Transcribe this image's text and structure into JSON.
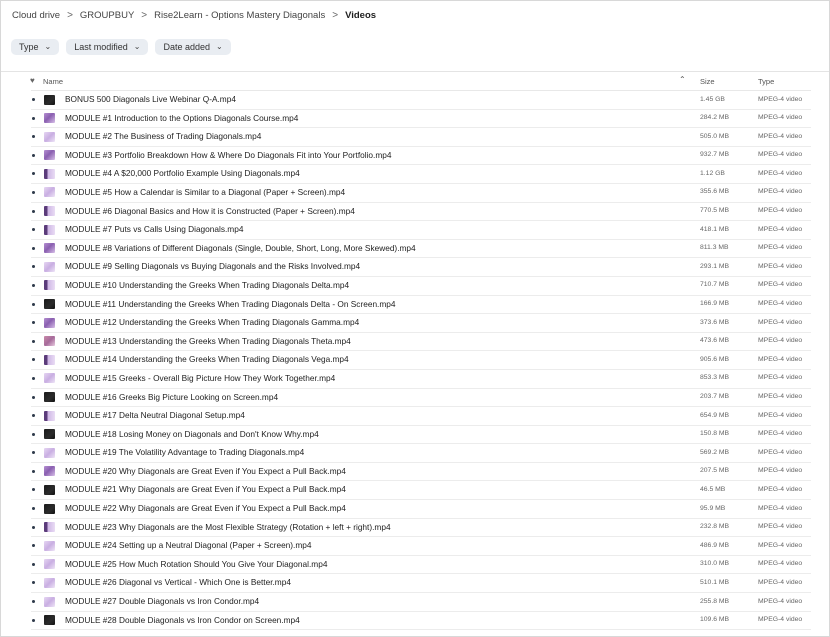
{
  "breadcrumb": {
    "items": [
      "Cloud drive",
      "GROUPBUY",
      "Rise2Learn - Options Mastery Diagonals",
      "Videos"
    ],
    "separator": ">"
  },
  "filters": [
    {
      "label": "Type"
    },
    {
      "label": "Last modified"
    },
    {
      "label": "Date added"
    }
  ],
  "table": {
    "columns": {
      "name": "Name",
      "size": "Size",
      "type": "Type"
    },
    "rows": [
      {
        "name": "BONUS 500 Diagonals Live Webinar Q-A.mp4",
        "size": "1.45 GB",
        "type": "MPEG-4 video",
        "thumb": "dark"
      },
      {
        "name": "MODULE #1 Introduction to the Options Diagonals Course.mp4",
        "size": "284.2 MB",
        "type": "MPEG-4 video",
        "thumb": "photo"
      },
      {
        "name": "MODULE #2 The Business of Trading Diagonals.mp4",
        "size": "505.0 MB",
        "type": "MPEG-4 video",
        "thumb": "lilac"
      },
      {
        "name": "MODULE #3 Portfolio Breakdown How & Where Do Diagonals Fit into Your Portfolio.mp4",
        "size": "932.7 MB",
        "type": "MPEG-4 video",
        "thumb": "photo"
      },
      {
        "name": "MODULE #4 A $20,000 Portfolio Example Using Diagonals.mp4",
        "size": "1.12 GB",
        "type": "MPEG-4 video",
        "thumb": "mixed"
      },
      {
        "name": "MODULE #5 How a Calendar is Similar to a Diagonal (Paper + Screen).mp4",
        "size": "355.6 MB",
        "type": "MPEG-4 video",
        "thumb": "lilac"
      },
      {
        "name": "MODULE #6 Diagonal Basics and How it is Constructed (Paper + Screen).mp4",
        "size": "770.5 MB",
        "type": "MPEG-4 video",
        "thumb": "mixed"
      },
      {
        "name": "MODULE #7 Puts vs Calls Using Diagonals.mp4",
        "size": "418.1 MB",
        "type": "MPEG-4 video",
        "thumb": "mixed"
      },
      {
        "name": "MODULE #8 Variations of Different Diagonals (Single, Double, Short, Long, More Skewed).mp4",
        "size": "811.3 MB",
        "type": "MPEG-4 video",
        "thumb": "photo"
      },
      {
        "name": "MODULE #9 Selling Diagonals vs Buying Diagonals and the Risks Involved.mp4",
        "size": "293.1 MB",
        "type": "MPEG-4 video",
        "thumb": "lilac"
      },
      {
        "name": "MODULE #10 Understanding the Greeks When Trading Diagonals Delta.mp4",
        "size": "710.7 MB",
        "type": "MPEG-4 video",
        "thumb": "mixed"
      },
      {
        "name": "MODULE #11 Understanding the Greeks When Trading Diagonals Delta - On Screen.mp4",
        "size": "166.9 MB",
        "type": "MPEG-4 video",
        "thumb": "dark"
      },
      {
        "name": "MODULE #12 Understanding the Greeks When Trading Diagonals Gamma.mp4",
        "size": "373.6 MB",
        "type": "MPEG-4 video",
        "thumb": "photo"
      },
      {
        "name": "MODULE #13 Understanding the Greeks When Trading Diagonals Theta.mp4",
        "size": "473.6 MB",
        "type": "MPEG-4 video",
        "thumb": "warm"
      },
      {
        "name": "MODULE #14 Understanding the Greeks When Trading Diagonals Vega.mp4",
        "size": "905.6 MB",
        "type": "MPEG-4 video",
        "thumb": "mixed"
      },
      {
        "name": "MODULE #15 Greeks - Overall Big Picture How They Work Together.mp4",
        "size": "853.3 MB",
        "type": "MPEG-4 video",
        "thumb": "lilac"
      },
      {
        "name": "MODULE #16 Greeks Big Picture Looking on Screen.mp4",
        "size": "203.7 MB",
        "type": "MPEG-4 video",
        "thumb": "dark"
      },
      {
        "name": "MODULE #17 Delta Neutral Diagonal Setup.mp4",
        "size": "654.9 MB",
        "type": "MPEG-4 video",
        "thumb": "mixed"
      },
      {
        "name": "MODULE #18 Losing Money on Diagonals and Don't Know Why.mp4",
        "size": "150.8 MB",
        "type": "MPEG-4 video",
        "thumb": "dark"
      },
      {
        "name": "MODULE #19 The Volatility Advantage to Trading Diagonals.mp4",
        "size": "569.2 MB",
        "type": "MPEG-4 video",
        "thumb": "lilac"
      },
      {
        "name": "MODULE #20 Why Diagonals are Great Even if You Expect a Pull Back.mp4",
        "size": "207.5 MB",
        "type": "MPEG-4 video",
        "thumb": "photo"
      },
      {
        "name": "MODULE #21 Why Diagonals are Great Even if You Expect a Pull Back.mp4",
        "size": "46.5 MB",
        "type": "MPEG-4 video",
        "thumb": "dark"
      },
      {
        "name": "MODULE #22 Why Diagonals are Great Even if You Expect a Pull Back.mp4",
        "size": "95.9 MB",
        "type": "MPEG-4 video",
        "thumb": "dark"
      },
      {
        "name": "MODULE #23 Why Diagonals are the Most Flexible Strategy (Rotation + left + right).mp4",
        "size": "232.8 MB",
        "type": "MPEG-4 video",
        "thumb": "mixed"
      },
      {
        "name": "MODULE #24 Setting up a Neutral Diagonal (Paper + Screen).mp4",
        "size": "486.9 MB",
        "type": "MPEG-4 video",
        "thumb": "lilac"
      },
      {
        "name": "MODULE #25 How Much Rotation Should You Give Your Diagonal.mp4",
        "size": "310.0 MB",
        "type": "MPEG-4 video",
        "thumb": "lilac"
      },
      {
        "name": "MODULE #26 Diagonal vs Vertical - Which One is Better.mp4",
        "size": "510.1 MB",
        "type": "MPEG-4 video",
        "thumb": "lilac"
      },
      {
        "name": "MODULE #27 Double Diagonals vs Iron Condor.mp4",
        "size": "255.8 MB",
        "type": "MPEG-4 video",
        "thumb": "lilac"
      },
      {
        "name": "MODULE #28 Double Diagonals vs Iron Condor on Screen.mp4",
        "size": "109.6 MB",
        "type": "MPEG-4 video",
        "thumb": "dark"
      }
    ]
  },
  "icons": {
    "header_favorite": "heart-icon",
    "sort": "sort-ascending-icon",
    "filter_chevron": "chevron-down-icon",
    "row_bullet": "dot-icon"
  }
}
